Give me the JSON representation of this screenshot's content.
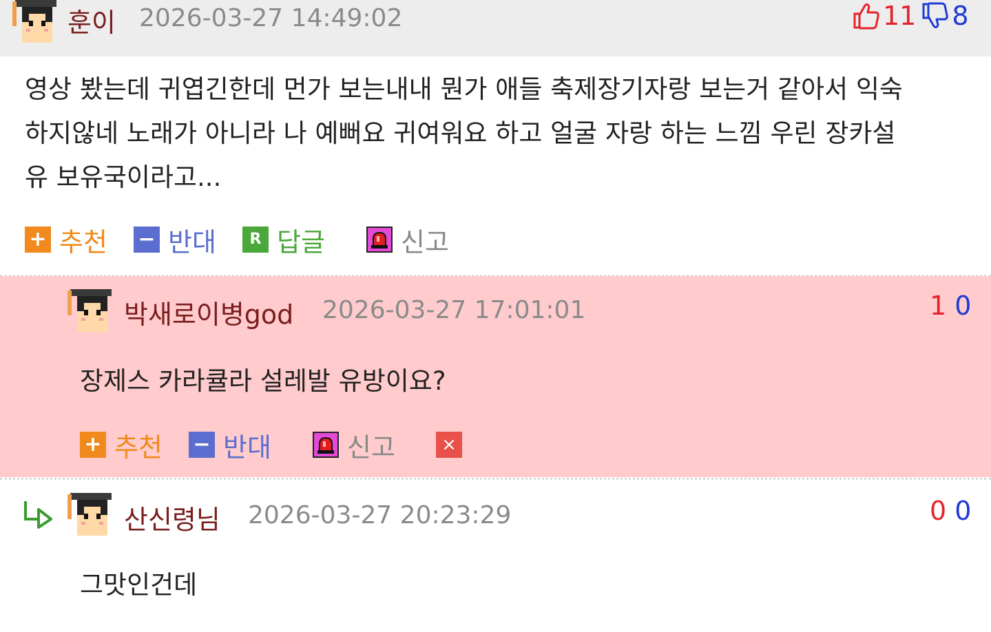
{
  "comment": {
    "author": "훈이",
    "timestamp": "2026-03-27 14:49:02",
    "likes": "11",
    "dislikes": "8",
    "text_lines": [
      "영상 봤는데 귀엽긴한데 먼가 보는내내 뭔가 애들 축제장기자랑 보는거 같아서 익숙",
      "하지않네 노래가 아니라 나 예뻐요 귀여워요 하고 얼굴 자랑 하는 느낌 우린 장카설",
      "유 보유국이라고..."
    ],
    "actions": {
      "recommend": "추천",
      "oppose": "반대",
      "reply": "답글",
      "report": "신고",
      "reply_icon_letter": "R"
    }
  },
  "replies": [
    {
      "author": "박새로이병god",
      "timestamp": "2026-03-27 17:01:01",
      "likes": "1",
      "dislikes": "0",
      "text": "장제스 카라큘라 설레발 유방이요?",
      "actions": {
        "recommend": "추천",
        "oppose": "반대",
        "report": "신고",
        "delete": "×"
      }
    },
    {
      "author": "산신령님",
      "timestamp": "2026-03-27 20:23:29",
      "likes": "0",
      "dislikes": "0",
      "text": "그맛인건데"
    }
  ],
  "colors": {
    "author": "#7a1d1d",
    "timestamp": "#8a8a8a",
    "like": "#e5222b",
    "dislike": "#1f3ad6",
    "recommend": "#f08a1c",
    "oppose": "#5b6ecf",
    "reply": "#4aa83a",
    "report": "#e34ad6",
    "highlight_bg": "#ffcbcd"
  }
}
